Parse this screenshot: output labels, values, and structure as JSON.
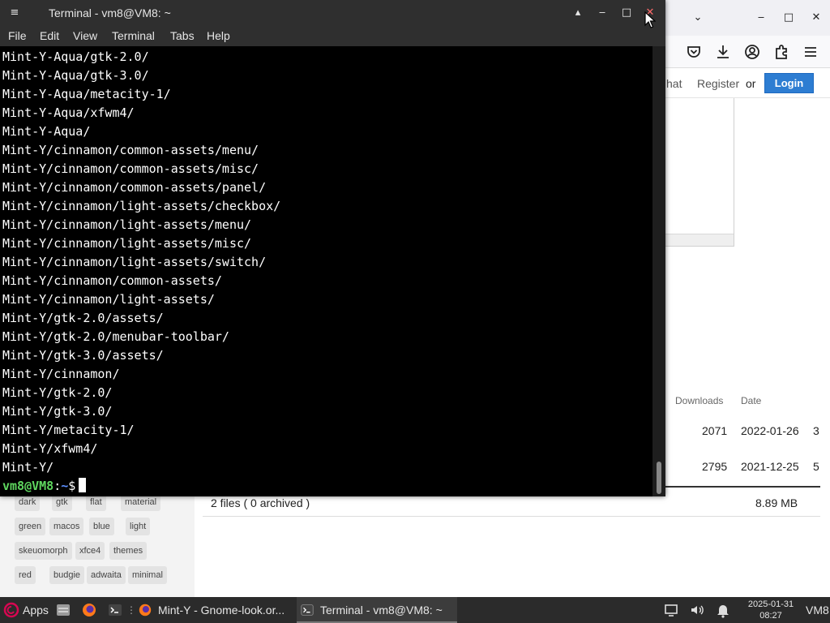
{
  "terminal": {
    "title": "Terminal - vm8@VM8: ~",
    "menu": [
      "File",
      "Edit",
      "View",
      "Terminal",
      "Tabs",
      "Help"
    ],
    "lines": [
      "Mint-Y-Aqua/gtk-2.0/",
      "Mint-Y-Aqua/gtk-3.0/",
      "Mint-Y-Aqua/metacity-1/",
      "Mint-Y-Aqua/xfwm4/",
      "Mint-Y-Aqua/",
      "Mint-Y/cinnamon/common-assets/menu/",
      "Mint-Y/cinnamon/common-assets/misc/",
      "Mint-Y/cinnamon/common-assets/panel/",
      "Mint-Y/cinnamon/light-assets/checkbox/",
      "Mint-Y/cinnamon/light-assets/menu/",
      "Mint-Y/cinnamon/light-assets/misc/",
      "Mint-Y/cinnamon/light-assets/switch/",
      "Mint-Y/cinnamon/common-assets/",
      "Mint-Y/cinnamon/light-assets/",
      "Mint-Y/gtk-2.0/assets/",
      "Mint-Y/gtk-2.0/menubar-toolbar/",
      "Mint-Y/gtk-3.0/assets/",
      "Mint-Y/cinnamon/",
      "Mint-Y/gtk-2.0/",
      "Mint-Y/gtk-3.0/",
      "Mint-Y/metacity-1/",
      "Mint-Y/xfwm4/",
      "Mint-Y/"
    ],
    "prompt": {
      "user": "vm8@VM8",
      "sep": ":",
      "path": "~",
      "symbol": "$"
    }
  },
  "browser": {
    "header": {
      "partial_link": "hat",
      "register": "Register",
      "or": "or",
      "login": "Login"
    },
    "files_table": {
      "columns": [
        "Downloads",
        "Date"
      ],
      "rows": [
        {
          "downloads": "2071",
          "date": "2022-01-26",
          "extra": "3"
        },
        {
          "downloads": "2795",
          "date": "2021-12-25",
          "extra": "5"
        }
      ],
      "summary_label": "2 files ( 0 archived )",
      "summary_size": "8.89 MB"
    },
    "tags": [
      "dark",
      "gtk",
      "flat",
      "material",
      "green",
      "macos",
      "blue",
      "light",
      "skeuomorph",
      "xfce4",
      "themes",
      "red",
      "budgie",
      "adwaita",
      "minimal"
    ]
  },
  "taskbar": {
    "apps_label": "Apps",
    "tasks": [
      {
        "label": "Mint-Y - Gnome-look.or..."
      },
      {
        "label": "Terminal - vm8@VM8: ~"
      }
    ],
    "clock": {
      "date": "2025-01-31",
      "time": "08:27"
    },
    "user": "VM8"
  },
  "colors": {
    "prompt_user": "#5fd75f",
    "prompt_path": "#5c8fff",
    "login_button": "#2d7dd2",
    "terminal_bg": "#000000"
  }
}
